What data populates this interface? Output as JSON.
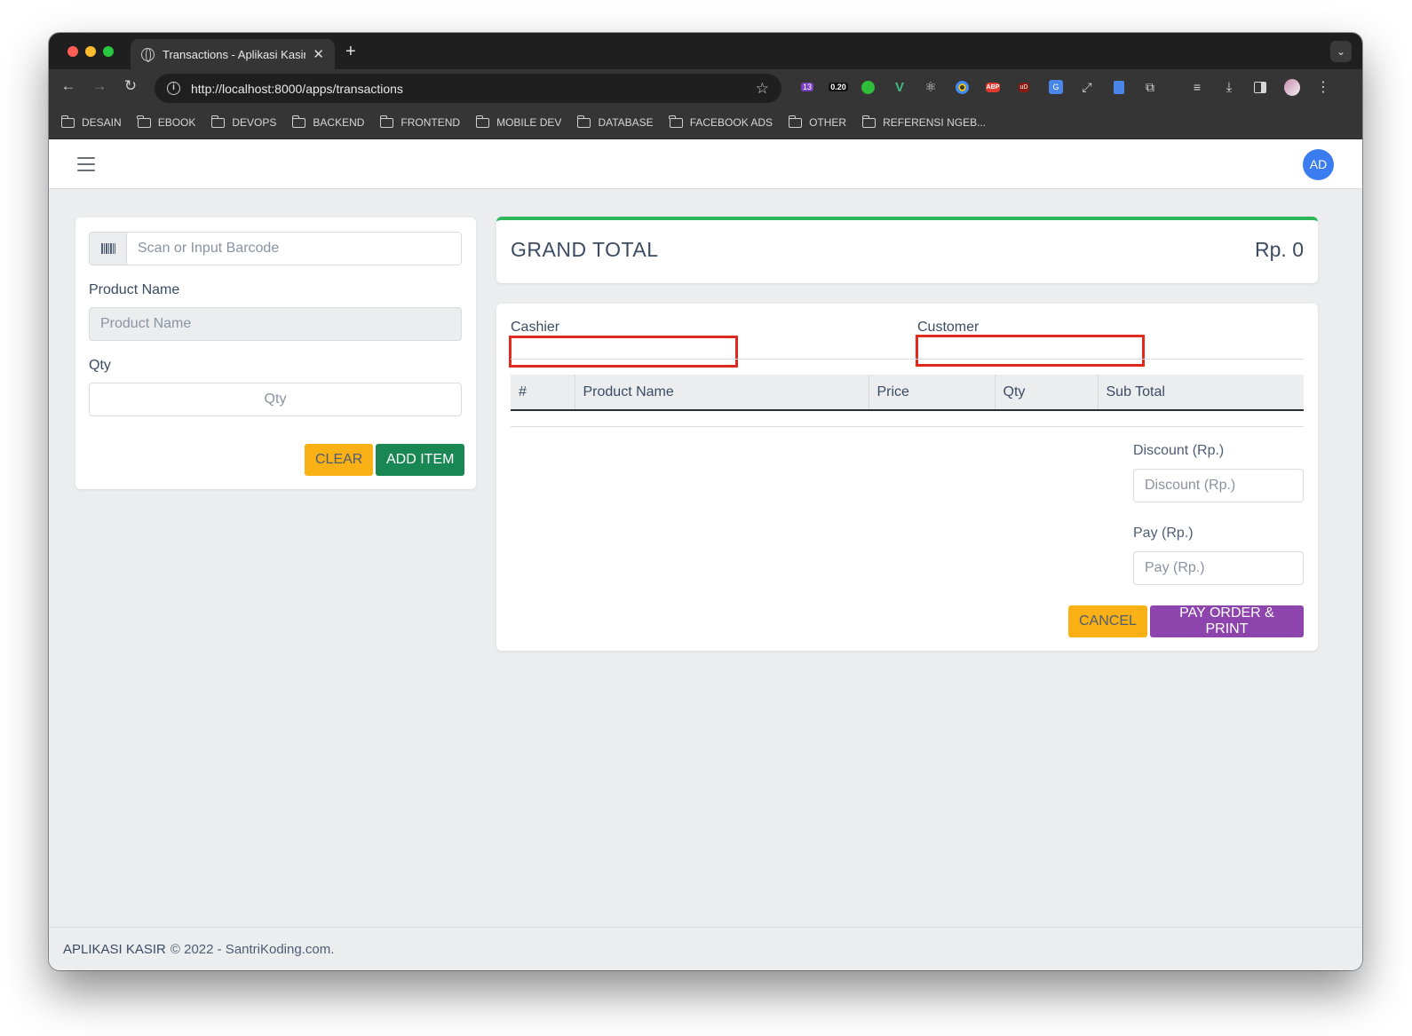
{
  "browser": {
    "tab_title": "Transactions - Aplikasi Kasir",
    "tab_close": "✕",
    "new_tab": "+",
    "tab_menu": "⌄",
    "url": "http://localhost:8000/apps/transactions",
    "ext_badge_1": "13",
    "ext_badge_2": "0.20",
    "ext_abp": "ABP",
    "ext_ud": "uD",
    "bookmarks": [
      "DESAIN",
      "EBOOK",
      "DEVOPS",
      "BACKEND",
      "FRONTEND",
      "MOBILE DEV",
      "DATABASE",
      "FACEBOOK ADS",
      "OTHER",
      "REFERENSI NGEB..."
    ]
  },
  "header": {
    "avatar_initials": "AD"
  },
  "left_form": {
    "barcode_placeholder": "Scan or Input Barcode",
    "product_name_label": "Product Name",
    "product_name_placeholder": "Product Name",
    "qty_label": "Qty",
    "qty_placeholder": "Qty",
    "clear_button": "CLEAR",
    "add_item_button": "ADD ITEM"
  },
  "grand_total": {
    "label": "GRAND TOTAL",
    "value": "Rp. 0"
  },
  "transaction": {
    "cashier_label": "Cashier",
    "customer_label": "Customer",
    "columns": [
      "#",
      "Product Name",
      "Price",
      "Qty",
      "Sub Total"
    ],
    "discount_label": "Discount (Rp.)",
    "discount_placeholder": "Discount (Rp.)",
    "pay_label": "Pay (Rp.)",
    "pay_placeholder": "Pay (Rp.)",
    "cancel_button": "CANCEL",
    "pay_button": "PAY ORDER & PRINT"
  },
  "footer": {
    "brand": "APLIKASI KASIR",
    "text": "© 2022 - SantriKoding.com."
  },
  "colors": {
    "accent_green": "#2eb85c",
    "warning": "#f9b115",
    "success": "#198754",
    "purple": "#8e44ad",
    "highlight_red": "#e02a1e"
  }
}
